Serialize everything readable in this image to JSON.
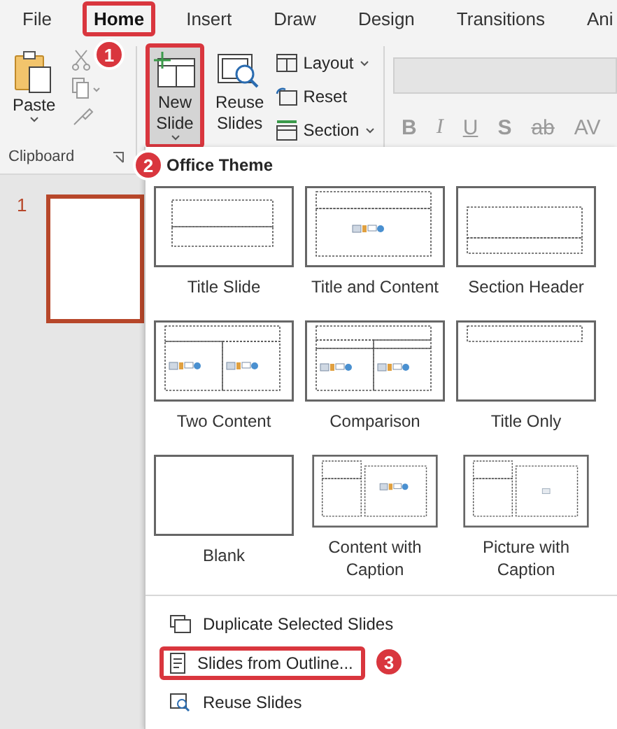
{
  "menu_tabs": [
    {
      "label": "File",
      "selected": false
    },
    {
      "label": "Home",
      "selected": true
    },
    {
      "label": "Insert",
      "selected": false
    },
    {
      "label": "Draw",
      "selected": false
    },
    {
      "label": "Design",
      "selected": false
    },
    {
      "label": "Transitions",
      "selected": false
    },
    {
      "label": "Ani",
      "selected": false
    }
  ],
  "ribbon": {
    "clipboard": {
      "paste": "Paste",
      "group_label": "Clipboard"
    },
    "slides": {
      "new_slide": {
        "label": "New Slide",
        "highlighted": true
      },
      "reuse_slides": "Reuse Slides",
      "commands": [
        {
          "label": "Layout",
          "dropdown": true,
          "kind": "layout"
        },
        {
          "label": "Reset",
          "dropdown": false,
          "kind": "reset"
        },
        {
          "label": "Section",
          "dropdown": true,
          "kind": "section"
        }
      ]
    },
    "font_buttons": [
      {
        "label": "B",
        "kind": "bold"
      },
      {
        "label": "I",
        "kind": "italic"
      },
      {
        "label": "U",
        "kind": "underline"
      },
      {
        "label": "S",
        "kind": "shadow"
      },
      {
        "label": "ab",
        "kind": "strike"
      },
      {
        "label": "AV",
        "kind": "spacing"
      }
    ]
  },
  "slides_pane": {
    "slide_number": "1",
    "selected": true
  },
  "new_slide_menu": {
    "heading": "Office Theme",
    "layouts": [
      {
        "label": "Title Slide",
        "kind": "title"
      },
      {
        "label": "Title and Content",
        "kind": "title-content"
      },
      {
        "label": "Section Header",
        "kind": "section"
      },
      {
        "label": "Two Content",
        "kind": "two-content"
      },
      {
        "label": "Comparison",
        "kind": "comparison"
      },
      {
        "label": "Title Only",
        "kind": "title-only"
      },
      {
        "label": "Blank",
        "kind": "blank"
      },
      {
        "label": "Content with Caption",
        "kind": "content-caption"
      },
      {
        "label": "Picture with Caption",
        "kind": "picture-caption"
      }
    ],
    "commands": [
      {
        "label": "Duplicate Selected Slides",
        "kind": "duplicate",
        "highlighted": false
      },
      {
        "label": "Slides from Outline...",
        "kind": "outline",
        "highlighted": true
      },
      {
        "label": "Reuse Slides",
        "kind": "reuse",
        "highlighted": false
      }
    ]
  },
  "callouts": [
    "1",
    "2",
    "3"
  ]
}
